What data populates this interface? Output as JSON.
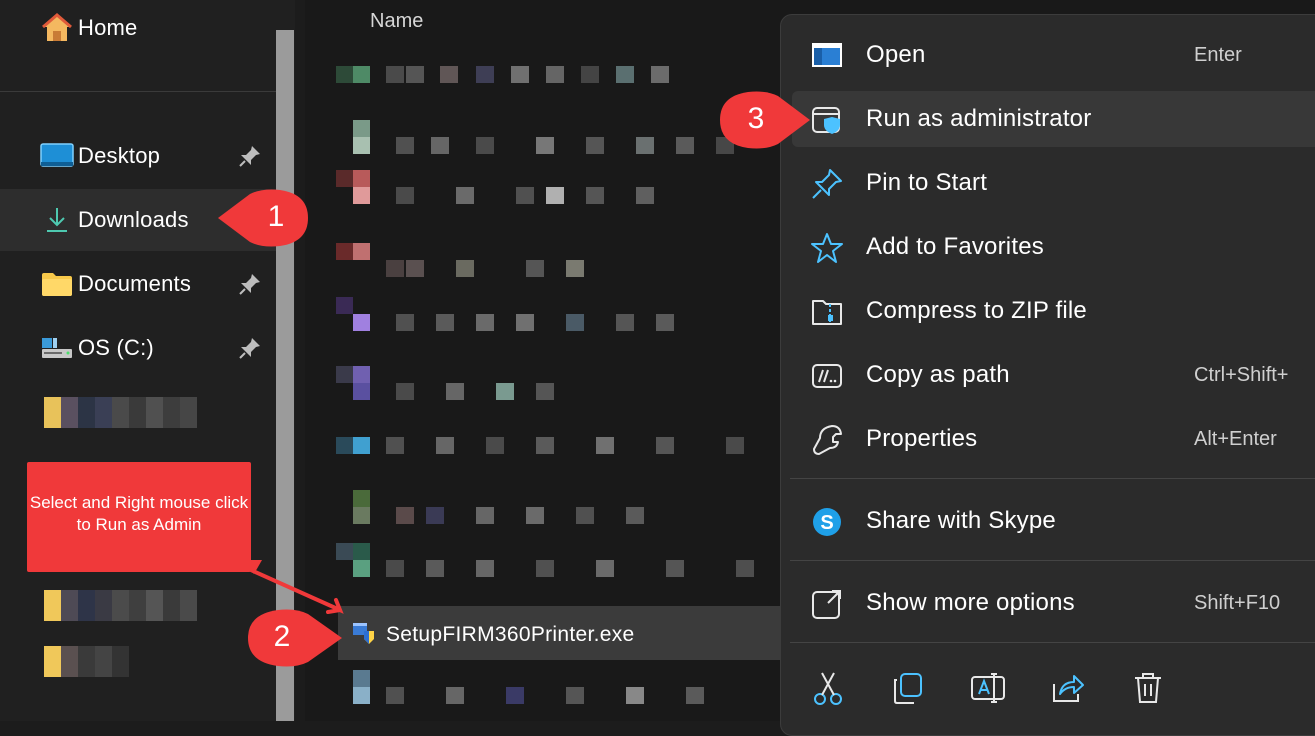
{
  "sidebar": {
    "home_label": "Home",
    "items": [
      {
        "label": "Desktop",
        "icon": "desktop-icon",
        "pinned": true
      },
      {
        "label": "Downloads",
        "icon": "download-icon",
        "pinned": false,
        "selected": true
      },
      {
        "label": "Documents",
        "icon": "folder-icon",
        "pinned": true
      },
      {
        "label": "OS (C:)",
        "icon": "drive-icon",
        "pinned": true
      }
    ]
  },
  "file_list": {
    "column_header": "Name",
    "selected_file": "SetupFIRM360Printer.exe"
  },
  "context_menu": {
    "items": [
      {
        "label": "Open",
        "shortcut": "Enter",
        "icon": "open-icon"
      },
      {
        "label": "Run as administrator",
        "shortcut": "",
        "icon": "shield-icon",
        "highlighted": true
      },
      {
        "label": "Pin to Start",
        "shortcut": "",
        "icon": "pin-icon"
      },
      {
        "label": "Add to Favorites",
        "shortcut": "",
        "icon": "star-icon"
      },
      {
        "label": "Compress to ZIP file",
        "shortcut": "",
        "icon": "zip-folder-icon"
      },
      {
        "label": "Copy as path",
        "shortcut": "Ctrl+Shift+",
        "icon": "path-icon"
      },
      {
        "label": "Properties",
        "shortcut": "Alt+Enter",
        "icon": "wrench-icon"
      },
      {
        "label": "Share with Skype",
        "shortcut": "",
        "icon": "skype-icon"
      },
      {
        "label": "Show more options",
        "shortcut": "Shift+F10",
        "icon": "more-options-icon"
      }
    ],
    "bottom_actions": [
      "cut-icon",
      "copy-icon",
      "rename-icon",
      "share-icon",
      "delete-icon"
    ]
  },
  "annotations": {
    "note": "Select and Right mouse click to Run as Admin",
    "step1": "1",
    "step2": "2",
    "step3": "3",
    "callout_color": "#f0393a"
  },
  "colors": {
    "accent_blue": "#4cc2ff",
    "download_green": "#4ec9b0",
    "folder_yellow": "#f8c94a"
  }
}
